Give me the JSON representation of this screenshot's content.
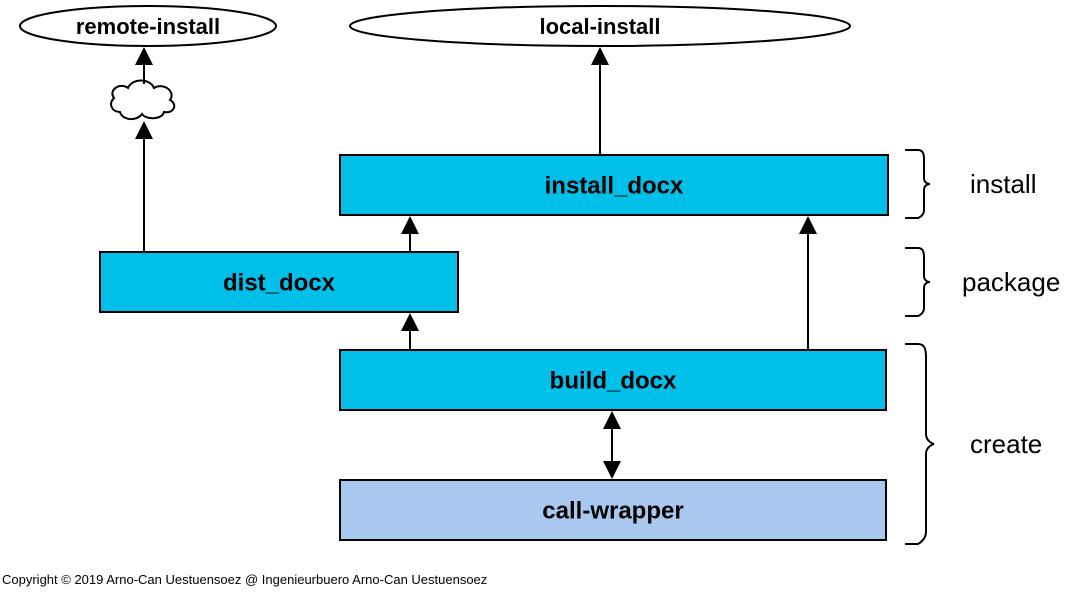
{
  "ovals": {
    "remote": "remote-install",
    "local": "local-install"
  },
  "boxes": {
    "install_docx": "install_docx",
    "dist_docx": "dist_docx",
    "build_docx": "build_docx",
    "call_wrapper": "call-wrapper"
  },
  "stages": {
    "install": "install",
    "package": "package",
    "create": "create"
  },
  "copyright": "Copyright © 2019 Arno-Can Uestuensoez @ Ingenieurbuero Arno-Can Uestuensoez"
}
